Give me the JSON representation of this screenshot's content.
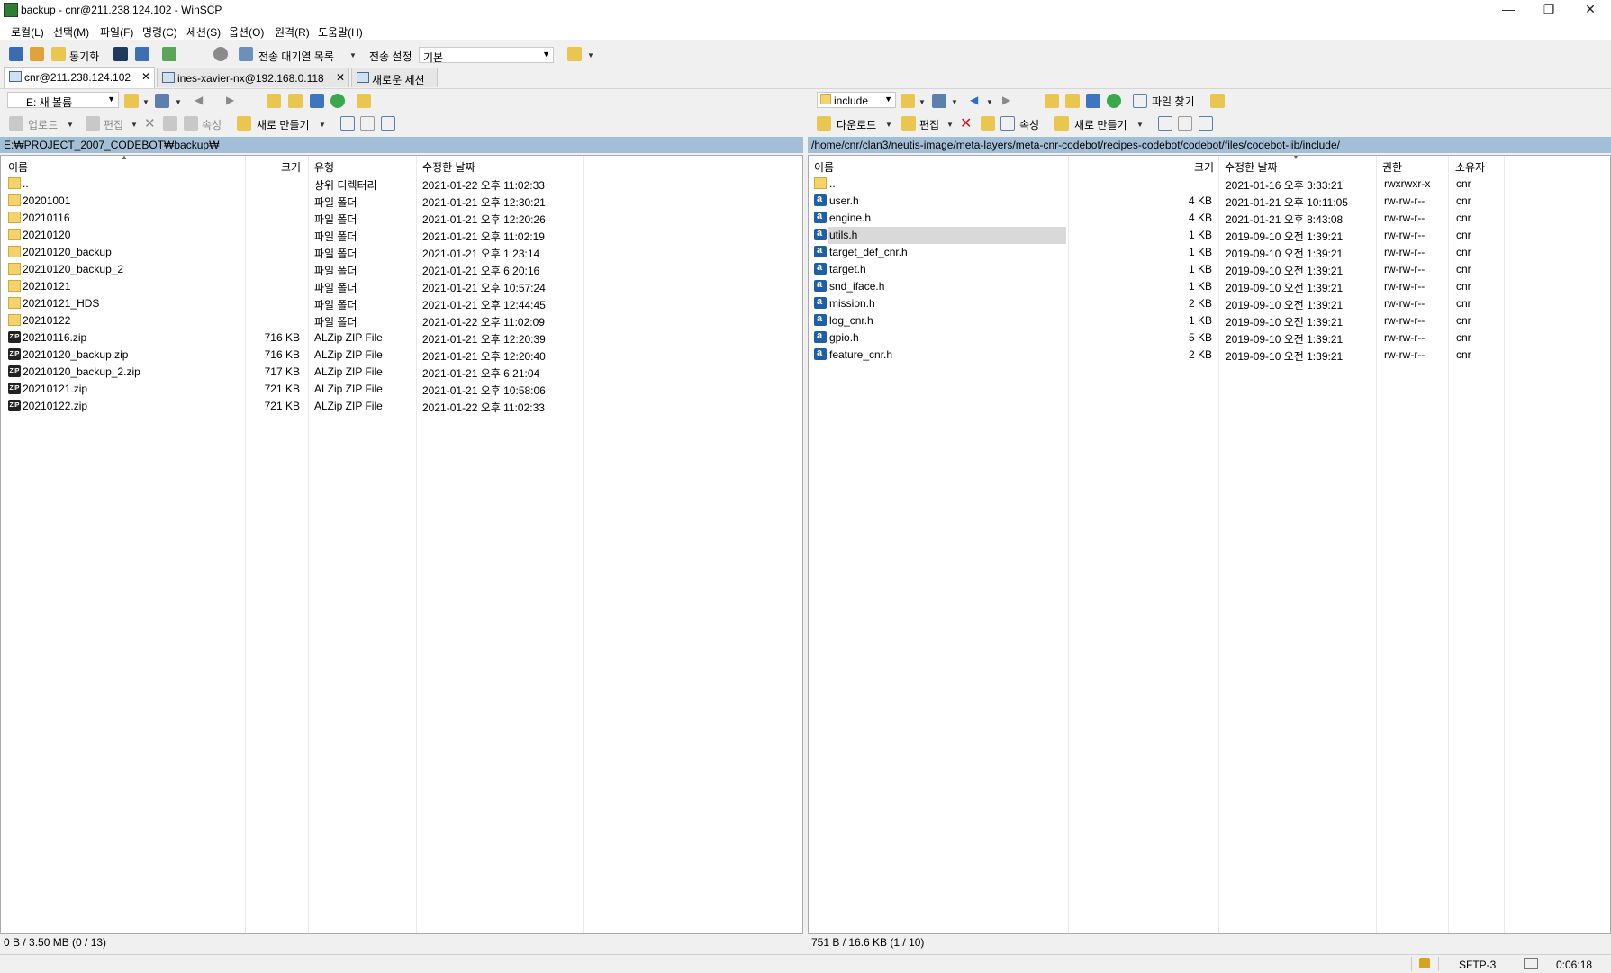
{
  "window": {
    "title": "backup - cnr@211.238.124.102 - WinSCP",
    "minimize": "—",
    "restore": "❐",
    "close": "✕"
  },
  "menu": [
    "로컬(L)",
    "선택(M)",
    "파일(F)",
    "명령(C)",
    "세션(S)",
    "옵션(O)",
    "원격(R)",
    "도움말(H)"
  ],
  "toolbar": {
    "sync_label": "동기화",
    "queue_label": "전송 대기열 목록",
    "transfer_settings_label": "전송 설정",
    "transfer_preset": "기본"
  },
  "tabs": [
    {
      "label": "cnr@211.238.124.102",
      "close": "✕"
    },
    {
      "label": "ines-xavier-nx@192.168.0.118",
      "close": "✕"
    },
    {
      "label": "새로운 세션"
    }
  ],
  "left": {
    "drive": "E: 새 볼륨",
    "upload_label": "업로드",
    "edit_label": "편집",
    "props_label": "속성",
    "new_label": "새로 만들기",
    "path": "E:₩PROJECT_2007_CODEBOT₩backup₩",
    "columns": [
      "이름",
      "크기",
      "유형",
      "수정한 날짜"
    ],
    "rows": [
      {
        "icon": "updir",
        "name": "..",
        "size": "",
        "type": "상위 디렉터리",
        "modified": "2021-01-22  오후 11:02:33"
      },
      {
        "icon": "folder",
        "name": "20201001",
        "size": "",
        "type": "파일 폴더",
        "modified": "2021-01-21  오후 12:30:21"
      },
      {
        "icon": "folder",
        "name": "20210116",
        "size": "",
        "type": "파일 폴더",
        "modified": "2021-01-21  오후 12:20:26"
      },
      {
        "icon": "folder",
        "name": "20210120",
        "size": "",
        "type": "파일 폴더",
        "modified": "2021-01-21  오후 11:02:19"
      },
      {
        "icon": "folder",
        "name": "20210120_backup",
        "size": "",
        "type": "파일 폴더",
        "modified": "2021-01-21  오후 1:23:14"
      },
      {
        "icon": "folder",
        "name": "20210120_backup_2",
        "size": "",
        "type": "파일 폴더",
        "modified": "2021-01-21  오후 6:20:16"
      },
      {
        "icon": "folder",
        "name": "20210121",
        "size": "",
        "type": "파일 폴더",
        "modified": "2021-01-21  오후 10:57:24"
      },
      {
        "icon": "folder",
        "name": "20210121_HDS",
        "size": "",
        "type": "파일 폴더",
        "modified": "2021-01-21  오후 12:44:45"
      },
      {
        "icon": "folder",
        "name": "20210122",
        "size": "",
        "type": "파일 폴더",
        "modified": "2021-01-22  오후 11:02:09"
      },
      {
        "icon": "zip",
        "name": "20210116.zip",
        "size": "716 KB",
        "type": "ALZip ZIP File",
        "modified": "2021-01-21  오후 12:20:39"
      },
      {
        "icon": "zip",
        "name": "20210120_backup.zip",
        "size": "716 KB",
        "type": "ALZip ZIP File",
        "modified": "2021-01-21  오후 12:20:40"
      },
      {
        "icon": "zip",
        "name": "20210120_backup_2.zip",
        "size": "717 KB",
        "type": "ALZip ZIP File",
        "modified": "2021-01-21  오후 6:21:04"
      },
      {
        "icon": "zip",
        "name": "20210121.zip",
        "size": "721 KB",
        "type": "ALZip ZIP File",
        "modified": "2021-01-21  오후 10:58:06"
      },
      {
        "icon": "zip",
        "name": "20210122.zip",
        "size": "721 KB",
        "type": "ALZip ZIP File",
        "modified": "2021-01-22  오후 11:02:33"
      }
    ],
    "status": "0 B / 3.50 MB (0 / 13)"
  },
  "right": {
    "folder": "include",
    "find_label": "파일 찾기",
    "download_label": "다운로드",
    "edit_label": "편집",
    "props_label": "속성",
    "new_label": "새로 만들기",
    "path": "/home/cnr/clan3/neutis-image/meta-layers/meta-cnr-codebot/recipes-codebot/codebot/files/codebot-lib/include/",
    "columns": [
      "이름",
      "크기",
      "수정한 날짜",
      "권한",
      "소유자"
    ],
    "rows": [
      {
        "icon": "updir",
        "name": "..",
        "size": "",
        "modified": "2021-01-16 오후 3:33:21",
        "rights": "rwxrwxr-x",
        "owner": "cnr"
      },
      {
        "icon": "h",
        "name": "user.h",
        "size": "4 KB",
        "modified": "2021-01-21 오후 10:11:05",
        "rights": "rw-rw-r--",
        "owner": "cnr"
      },
      {
        "icon": "h",
        "name": "engine.h",
        "size": "4 KB",
        "modified": "2021-01-21 오후 8:43:08",
        "rights": "rw-rw-r--",
        "owner": "cnr"
      },
      {
        "icon": "h",
        "name": "utils.h",
        "size": "1 KB",
        "modified": "2019-09-10 오전 1:39:21",
        "rights": "rw-rw-r--",
        "owner": "cnr",
        "selected": true
      },
      {
        "icon": "h",
        "name": "target_def_cnr.h",
        "size": "1 KB",
        "modified": "2019-09-10 오전 1:39:21",
        "rights": "rw-rw-r--",
        "owner": "cnr"
      },
      {
        "icon": "h",
        "name": "target.h",
        "size": "1 KB",
        "modified": "2019-09-10 오전 1:39:21",
        "rights": "rw-rw-r--",
        "owner": "cnr"
      },
      {
        "icon": "h",
        "name": "snd_iface.h",
        "size": "1 KB",
        "modified": "2019-09-10 오전 1:39:21",
        "rights": "rw-rw-r--",
        "owner": "cnr"
      },
      {
        "icon": "h",
        "name": "mission.h",
        "size": "2 KB",
        "modified": "2019-09-10 오전 1:39:21",
        "rights": "rw-rw-r--",
        "owner": "cnr"
      },
      {
        "icon": "h",
        "name": "log_cnr.h",
        "size": "1 KB",
        "modified": "2019-09-10 오전 1:39:21",
        "rights": "rw-rw-r--",
        "owner": "cnr"
      },
      {
        "icon": "h",
        "name": "gpio.h",
        "size": "5 KB",
        "modified": "2019-09-10 오전 1:39:21",
        "rights": "rw-rw-r--",
        "owner": "cnr"
      },
      {
        "icon": "h",
        "name": "feature_cnr.h",
        "size": "2 KB",
        "modified": "2019-09-10 오전 1:39:21",
        "rights": "rw-rw-r--",
        "owner": "cnr"
      }
    ],
    "status": "751 B / 16.6 KB (1 / 10)"
  },
  "statusbar": {
    "protocol": "SFTP-3",
    "elapsed": "0:06:18"
  }
}
